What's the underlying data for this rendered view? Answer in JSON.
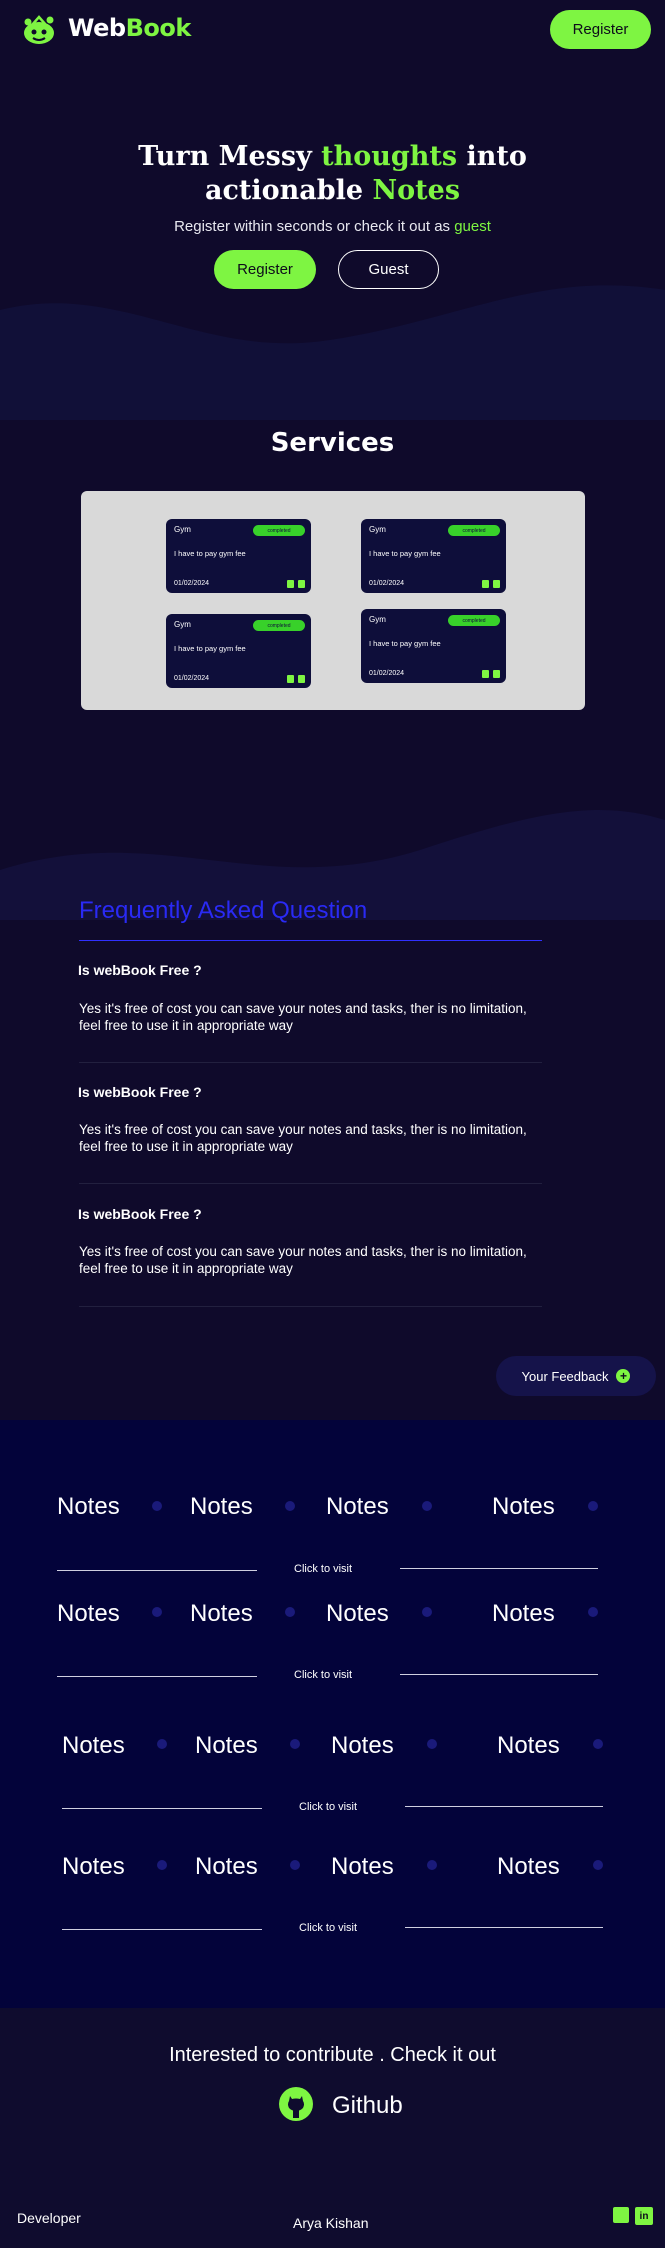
{
  "nav": {
    "logo_part1": "Web",
    "logo_part2": "Book",
    "register_label": "Register"
  },
  "hero": {
    "line1_a": "Turn Messy ",
    "line1_b": "thoughts",
    "line1_c": " into",
    "line2_a": "actionable ",
    "line2_b": "Notes",
    "sub_a": "Register within seconds or check it out as ",
    "sub_b": "guest",
    "register_label": "Register",
    "guest_label": "Guest"
  },
  "services": {
    "title": "Services",
    "cards": [
      {
        "category": "Gym",
        "status": "completed",
        "text": "I have to pay gym fee",
        "date": "01/02/2024"
      },
      {
        "category": "Gym",
        "status": "completed",
        "text": "I have to pay gym fee",
        "date": "01/02/2024"
      },
      {
        "category": "Gym",
        "status": "completed",
        "text": "I have to pay gym fee",
        "date": "01/02/2024"
      },
      {
        "category": "Gym",
        "status": "completed",
        "text": "I have to pay gym fee",
        "date": "01/02/2024"
      }
    ]
  },
  "faq": {
    "title": "Frequently Asked Question",
    "items": [
      {
        "q": "Is webBook Free ?",
        "a": "Yes it's free of cost you can save your notes and tasks, ther is no limitation, feel free to use it in appropriate way"
      },
      {
        "q": "Is webBook Free ?",
        "a": "Yes it's free of cost you can save your notes and tasks, ther is no limitation, feel free to use it in appropriate way"
      },
      {
        "q": "Is webBook Free ?",
        "a": "Yes it's free of cost you can save your notes and tasks, ther is no limitation, feel free to use it in appropriate way"
      }
    ]
  },
  "feedback": {
    "label": "Your Feedback",
    "icon": "plus-icon"
  },
  "banner": {
    "word": "Notes",
    "visit_label": "Click to visit"
  },
  "contribute": {
    "title": "Interested to contribute . Check it out",
    "github_label": "Github"
  },
  "footer": {
    "developer_label": "Developer",
    "developer_name": "Arya Kishan"
  },
  "colors": {
    "accent": "#7ef542",
    "background": "#0f0a2b",
    "faq_title": "#2a2af5"
  }
}
